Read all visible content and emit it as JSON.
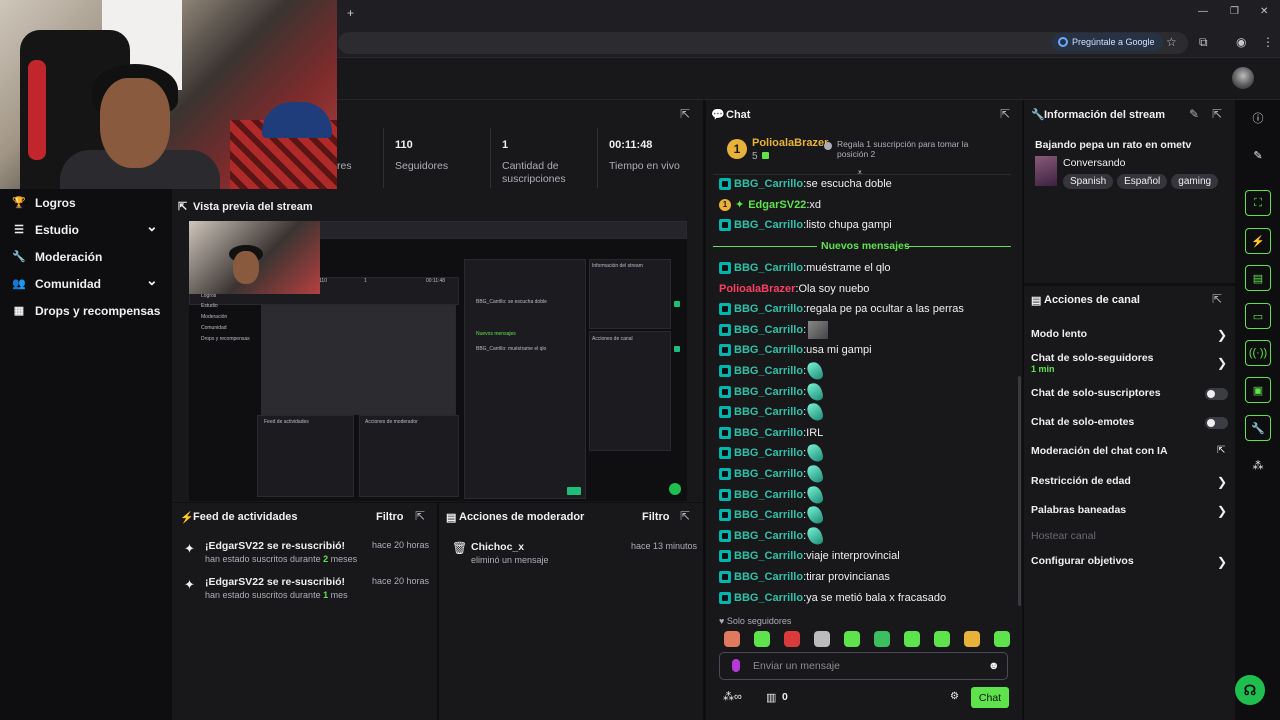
{
  "browser": {
    "ask_google": "Pregúntale a Google",
    "new_tab": "+",
    "controls": [
      "—",
      "❐",
      "✕"
    ]
  },
  "sidebar": {
    "items": [
      {
        "label": "Logros",
        "icon": "trophy-icon",
        "glyph": "🏆",
        "expandable": false
      },
      {
        "label": "Estudio",
        "icon": "studio-icon",
        "glyph": "☰",
        "expandable": true
      },
      {
        "label": "Moderación",
        "icon": "wrench-icon",
        "glyph": "🔧",
        "expandable": false
      },
      {
        "label": "Comunidad",
        "icon": "community-icon",
        "glyph": "👥",
        "expandable": true
      },
      {
        "label": "Drops y recompensas",
        "icon": "gift-icon",
        "glyph": "▦",
        "expandable": false
      }
    ]
  },
  "stats": {
    "partial_label": "res",
    "followers_value": "110",
    "followers_label": "Seguidores",
    "subs_value": "1",
    "subs_label": "Cantidad de suscripciones",
    "live_value": "00:11:48",
    "live_label": "Tiempo en vivo"
  },
  "preview": {
    "title": "Vista previa del stream"
  },
  "feed": {
    "title": "Feed de actividades",
    "filter": "Filtro",
    "items": [
      {
        "title": "¡EdgarSV22 se re-suscribió!",
        "sub_pre": "han estado suscritos durante ",
        "count": "2",
        "unit": " meses",
        "time": "hace 20 horas"
      },
      {
        "title": "¡EdgarSV22 se re-suscribió!",
        "sub_pre": "han estado suscritos durante ",
        "count": "1",
        "unit": " mes",
        "time": "hace 20 horas"
      }
    ]
  },
  "modactions": {
    "title": "Acciones de moderador",
    "filter": "Filtro",
    "items": [
      {
        "user": "Chichoc_x",
        "action": "eliminó un mensaje",
        "time": "hace 13 minutos"
      }
    ]
  },
  "chat": {
    "title": "Chat",
    "top_user": "PolioalaBrazer",
    "top_count": "5",
    "gift_text": "Regala 1 suscripción para tomar la posición 2",
    "new_messages": "Nuevos mensajes",
    "messages_before": [
      {
        "user": "BBG_Carrillo",
        "text": "se escucha doble",
        "color": "teal",
        "badge": "mod"
      },
      {
        "user": "EdgarSV22",
        "text": "xd",
        "color": "green",
        "badge": "sub"
      },
      {
        "user": "BBG_Carrillo",
        "text": "listo chupa gampi",
        "color": "teal",
        "badge": "mod"
      }
    ],
    "messages_after": [
      {
        "user": "BBG_Carrillo",
        "text": "muéstrame el qlo",
        "color": "teal",
        "badge": "mod"
      },
      {
        "user": "PolioalaBrazer",
        "text": "Ola soy nuebo",
        "color": "red",
        "badge": "none"
      },
      {
        "user": "BBG_Carrillo",
        "text": "regala pe pa ocultar a las perras",
        "color": "teal",
        "badge": "mod"
      },
      {
        "user": "BBG_Carrillo",
        "text": "",
        "color": "teal",
        "badge": "mod",
        "image": "photo"
      },
      {
        "user": "BBG_Carrillo",
        "text": "usa mi gampi",
        "color": "teal",
        "badge": "mod"
      },
      {
        "user": "BBG_Carrillo",
        "text": "",
        "color": "teal",
        "badge": "mod",
        "image": "emote"
      },
      {
        "user": "BBG_Carrillo",
        "text": "",
        "color": "teal",
        "badge": "mod",
        "image": "emote"
      },
      {
        "user": "BBG_Carrillo",
        "text": "",
        "color": "teal",
        "badge": "mod",
        "image": "emote"
      },
      {
        "user": "BBG_Carrillo",
        "text": "IRL",
        "color": "teal",
        "badge": "mod"
      },
      {
        "user": "BBG_Carrillo",
        "text": "",
        "color": "teal",
        "badge": "mod",
        "image": "emote"
      },
      {
        "user": "BBG_Carrillo",
        "text": "",
        "color": "teal",
        "badge": "mod",
        "image": "emote"
      },
      {
        "user": "BBG_Carrillo",
        "text": "",
        "color": "teal",
        "badge": "mod",
        "image": "emote"
      },
      {
        "user": "BBG_Carrillo",
        "text": "",
        "color": "teal",
        "badge": "mod",
        "image": "emote"
      },
      {
        "user": "BBG_Carrillo",
        "text": "",
        "color": "teal",
        "badge": "mod",
        "image": "emote"
      },
      {
        "user": "BBG_Carrillo",
        "text": "viaje interprovincial",
        "color": "teal",
        "badge": "mod"
      },
      {
        "user": "BBG_Carrillo",
        "text": "tirar provincianas",
        "color": "teal",
        "badge": "mod"
      },
      {
        "user": "BBG_Carrillo",
        "text": "ya se metió bala x fracasado",
        "color": "teal",
        "badge": "mod"
      }
    ],
    "followers_only": "Solo seguidores",
    "input_placeholder": "Enviar un mensaje",
    "points": "0",
    "send": "Chat"
  },
  "info": {
    "title": "Información del stream",
    "stream_title": "Bajando pepa un rato en ometv",
    "category": "Conversando",
    "tags": [
      "Spanish",
      "Español",
      "gaming"
    ]
  },
  "channel_actions": {
    "title": "Acciones de canal",
    "items": [
      {
        "label": "Modo lento",
        "control": "chevron"
      },
      {
        "label": "Chat de solo-seguidores",
        "sub": "1 min",
        "control": "chevron"
      },
      {
        "label": "Chat de solo-suscriptores",
        "control": "toggle"
      },
      {
        "label": "Chat de solo-emotes",
        "control": "toggle"
      },
      {
        "label": "Moderación del chat con IA",
        "control": "external"
      },
      {
        "label": "Restricción de edad",
        "control": "chevron"
      },
      {
        "label": "Palabras baneadas",
        "control": "chevron"
      },
      {
        "label": "Hostear canal",
        "control": "disabled"
      },
      {
        "label": "Configurar objetivos",
        "control": "chevron"
      }
    ]
  },
  "colors": {
    "accent": "#5fe34c",
    "mod_name": "#30c1a8",
    "red_name": "#ff3f62",
    "panel": "#18181b",
    "bg": "#0e0e10"
  }
}
